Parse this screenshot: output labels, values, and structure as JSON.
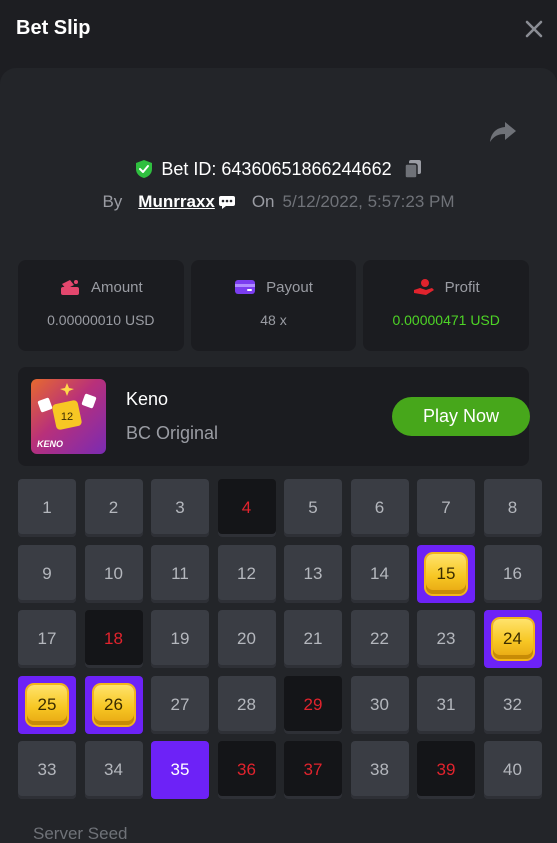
{
  "header": {
    "title": "Bet Slip"
  },
  "bet": {
    "id_text": "Bet ID: 64360651866244662",
    "by_label": "By",
    "username": "Munrraxx",
    "on_label": "On",
    "date": "5/12/2022, 5:57:23 PM"
  },
  "stats": [
    {
      "label": "Amount",
      "value": "0.00000010 USD",
      "icon": "money-bag-icon",
      "color": "#e3476d"
    },
    {
      "label": "Payout",
      "value": "48 x",
      "icon": "card-icon",
      "color": "#7b3df0"
    },
    {
      "label": "Profit",
      "value": "0.00000471 USD",
      "icon": "hand-money-icon",
      "color": "#e1232d"
    }
  ],
  "game": {
    "name": "Keno",
    "subtitle": "BC Original",
    "play_label": "Play Now",
    "thumb_text": "KENO",
    "thumb_badge": "12"
  },
  "keno": {
    "numbers": [
      "1",
      "2",
      "3",
      "4",
      "5",
      "6",
      "7",
      "8",
      "9",
      "10",
      "11",
      "12",
      "13",
      "14",
      "15",
      "16",
      "17",
      "18",
      "19",
      "20",
      "21",
      "22",
      "23",
      "24",
      "25",
      "26",
      "27",
      "28",
      "29",
      "30",
      "31",
      "32",
      "33",
      "34",
      "35",
      "36",
      "37",
      "38",
      "39",
      "40"
    ],
    "hits": [
      15,
      24,
      25,
      26
    ],
    "picked_no_hit": [
      35
    ],
    "drawn_misses": [
      4,
      18,
      29,
      36,
      37,
      39
    ]
  },
  "server_seed_label": "Server Seed",
  "colors": {
    "accent_purple": "#6d22f7",
    "green_button": "#47a71b",
    "profit_green": "#4ed426",
    "miss_red": "#e1232d"
  }
}
